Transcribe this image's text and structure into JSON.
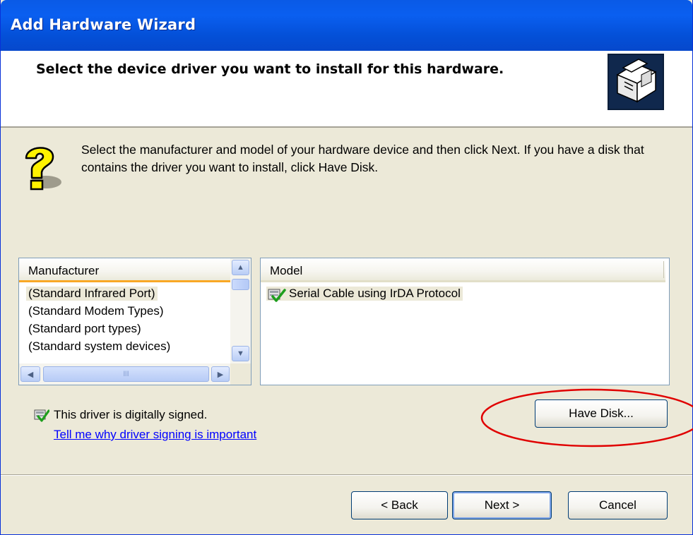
{
  "window": {
    "title": "Add Hardware Wizard"
  },
  "header": {
    "heading": "Select the device driver you want to install for this hardware."
  },
  "instructions": {
    "text": "Select the manufacturer and model of your hardware device and then click Next. If you have a disk that contains the driver you want to install, click Have Disk."
  },
  "manufacturer_list": {
    "header": "Manufacturer",
    "items": [
      "(Standard Infrared Port)",
      "(Standard Modem Types)",
      "(Standard port types)",
      "(Standard system devices)"
    ],
    "selected_index": 0
  },
  "model_list": {
    "header": "Model",
    "items": [
      "Serial Cable using IrDA Protocol"
    ],
    "selected_index": 0
  },
  "driver_status": {
    "signed_text": "This driver is digitally signed.",
    "link_text": "Tell me why driver signing is important"
  },
  "buttons": {
    "have_disk": "Have Disk...",
    "back": "< Back",
    "next": "Next >",
    "cancel": "Cancel"
  },
  "icons": {
    "header": "hardware-box-icon",
    "help": "question-mark-icon",
    "signed": "signed-driver-icon"
  },
  "colors": {
    "title_bar": "#0a5ae6",
    "annotation_circle": "#e00000",
    "link": "#0000ff"
  }
}
